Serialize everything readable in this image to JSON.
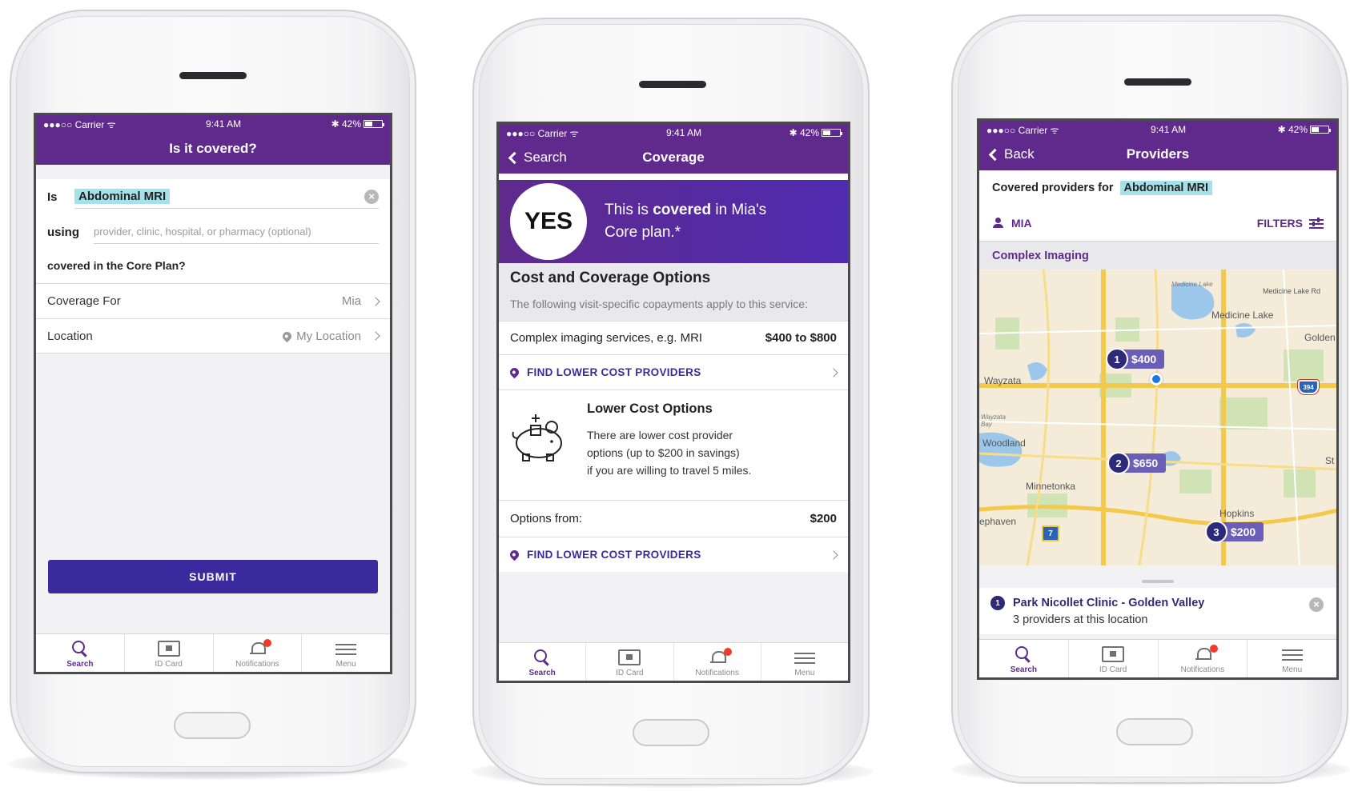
{
  "status": {
    "carrier": "●●●○○ Carrier ᯤ",
    "time": "9:41 AM",
    "battery": "✱ 42%"
  },
  "tabs": [
    {
      "label": "Search"
    },
    {
      "label": "ID Card"
    },
    {
      "label": "Notifications"
    },
    {
      "label": "Menu"
    }
  ],
  "screen1": {
    "title": "Is it covered?",
    "is_label": "Is",
    "service_value": "Abdominal MRI",
    "using_label": "using",
    "using_placeholder": "provider, clinic, hospital, or pharmacy (optional)",
    "covered_text": "covered in the Core Plan?",
    "coverage_for_label": "Coverage For",
    "coverage_for_value": "Mia",
    "location_label": "Location",
    "location_value": "My Location",
    "submit_label": "SUBMIT"
  },
  "screen2": {
    "back_label": "Search",
    "title": "Coverage",
    "yes": "YES",
    "banner_pre": "This is ",
    "banner_bold": "covered",
    "banner_post": " in Mia's",
    "banner_line2": "Core plan.*",
    "section_title": "Cost and Coverage Options",
    "section_desc": "The following visit-specific copayments apply to this service:",
    "service_name": "Complex imaging services, e.g. MRI",
    "service_cost": "$400 to $800",
    "find_link_1": "FIND LOWER COST PROVIDERS",
    "lco_title": "Lower Cost Options",
    "lco_line1": "There are lower cost provider",
    "lco_line2": "options (up to $200 in savings)",
    "lco_line3": "if you are willing to travel 5 miles.",
    "options_from_label": "Options from:",
    "options_from_value": "$200",
    "find_link_2": "FIND LOWER COST PROVIDERS"
  },
  "screen3": {
    "back_label": "Back",
    "title": "Providers",
    "covered_for_label": "Covered providers for",
    "service_value": "Abdominal MRI",
    "member": "MIA",
    "filters_label": "FILTERS",
    "category": "Complex Imaging",
    "map_labels": [
      "Medicine Lake",
      "Medicine Lake",
      "Medicine Lake Rd",
      "Golden",
      "Wayzata",
      "Wayzata Bay",
      "Woodland",
      "Minnetonka",
      "Hopkins",
      "ephaven",
      "St"
    ],
    "pins": [
      {
        "num": "1",
        "amount": "$400"
      },
      {
        "num": "2",
        "amount": "$650"
      },
      {
        "num": "3",
        "amount": "$200"
      }
    ],
    "shield_394": "394",
    "shield_7": "7",
    "sheet_num": "1",
    "sheet_title": "Park Nicollet Clinic - Golden Valley",
    "sheet_sub": "3 providers at this location"
  }
}
